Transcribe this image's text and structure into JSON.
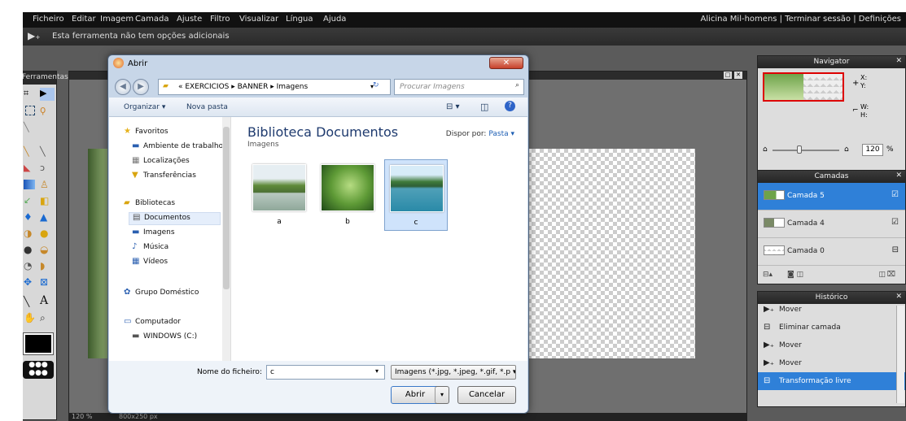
{
  "menu": {
    "items": [
      "Ficheiro",
      "Editar",
      "Imagem",
      "Camada",
      "Ajuste",
      "Filtro",
      "Visualizar",
      "Língua",
      "Ajuda"
    ],
    "account": "Alicina Mil-homens | Terminar sessão | Definições"
  },
  "options": {
    "text": "Esta ferramenta não tem opções adicionais"
  },
  "toolbox": {
    "title": "Ferramentas"
  },
  "status": {
    "zoom": "120 %",
    "size": "800x250 px"
  },
  "navigator": {
    "title": "Navigator",
    "x_label": "X:",
    "y_label": "Y:",
    "w_label": "W:",
    "h_label": "H:",
    "zoom": "120",
    "pct": "%"
  },
  "layers": {
    "title": "Camadas",
    "items": [
      {
        "name": "Camada 5"
      },
      {
        "name": "Camada 4"
      },
      {
        "name": "Camada 0"
      }
    ]
  },
  "history": {
    "title": "Histórico",
    "items": [
      "Mover",
      "Eliminar camada",
      "Mover",
      "Mover",
      "Transformação livre"
    ]
  },
  "dialog": {
    "title": "Abrir",
    "path": "« EXERCICIOS ▸ BANNER ▸ Imagens",
    "search_placeholder": "Procurar Imagens",
    "organize": "Organizar ▾",
    "new_folder": "Nova pasta",
    "nav": {
      "favorites": "Favoritos",
      "desktop": "Ambiente de trabalho",
      "locations": "Localizações",
      "downloads": "Transferências",
      "libraries": "Bibliotecas",
      "documents": "Documentos",
      "images": "Imagens",
      "music": "Música",
      "videos": "Vídeos",
      "homegroup": "Grupo Doméstico",
      "computer": "Computador",
      "drive": "WINDOWS (C:)"
    },
    "library_title": "Biblioteca Documentos",
    "library_sub": "Imagens",
    "arrange_label": "Dispor por:",
    "arrange_value": "Pasta ▾",
    "files": [
      {
        "name": "a"
      },
      {
        "name": "b"
      },
      {
        "name": "c"
      }
    ],
    "filename_label": "Nome do ficheiro:",
    "filename_value": "c",
    "filetype": "Imagens (*.jpg, *.jpeg, *.gif, *.p ▾",
    "open": "Abrir",
    "cancel": "Cancelar"
  }
}
